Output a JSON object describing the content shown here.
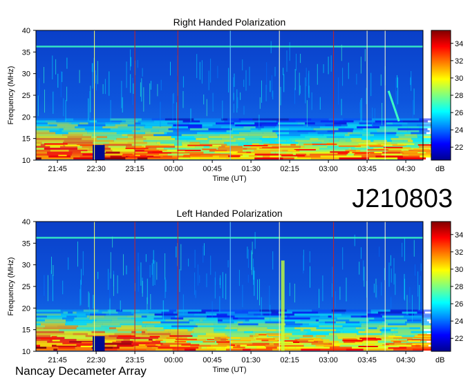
{
  "figure": {
    "dataset_id": "J210803",
    "footer": "Nancay Decameter Array"
  },
  "chart_data": [
    {
      "type": "heatmap",
      "title": "Right Handed Polarization",
      "xlabel": "Time (UT)",
      "ylabel": "Frequency (MHz)",
      "x_ticks": [
        "21:45",
        "22:30",
        "23:15",
        "00:00",
        "00:45",
        "01:30",
        "02:15",
        "03:00",
        "03:45",
        "04:30"
      ],
      "y_ticks": [
        10,
        15,
        20,
        25,
        30,
        35,
        40
      ],
      "ylim": [
        10,
        40
      ],
      "colorbar": {
        "label": "dB",
        "ticks": [
          22,
          24,
          26,
          28,
          30,
          32,
          34
        ],
        "range": [
          20.5,
          35.5
        ]
      },
      "features": [
        {
          "name": "low-frequency emission band",
          "freq_range_mhz": [
            10,
            19
          ],
          "level_db": 28
        },
        {
          "name": "interference line",
          "freq_mhz": 36.3,
          "level_db": 27
        },
        {
          "name": "drifting burst",
          "time_range": [
            "04:10",
            "04:22"
          ],
          "freq_range_mhz": [
            19,
            26
          ],
          "level_db": 27
        }
      ]
    },
    {
      "type": "heatmap",
      "title": "Left Handed Polarization",
      "xlabel": "Time (UT)",
      "ylabel": "Frequency (MHz)",
      "x_ticks": [
        "21:45",
        "22:30",
        "23:15",
        "00:00",
        "00:45",
        "01:30",
        "02:15",
        "03:00",
        "03:45",
        "04:30"
      ],
      "y_ticks": [
        10,
        15,
        20,
        25,
        30,
        35,
        40
      ],
      "ylim": [
        10,
        40
      ],
      "colorbar": {
        "label": "dB",
        "ticks": [
          22,
          24,
          26,
          28,
          30,
          32,
          34
        ],
        "range": [
          20.5,
          35.5
        ]
      },
      "features": [
        {
          "name": "low-frequency emission band",
          "freq_range_mhz": [
            10,
            20
          ],
          "level_db": 29
        },
        {
          "name": "interference line",
          "freq_mhz": 36.3,
          "level_db": 27
        },
        {
          "name": "vertical burst",
          "time": "02:05",
          "freq_range_mhz": [
            10,
            31
          ],
          "level_db": 29
        }
      ]
    }
  ]
}
